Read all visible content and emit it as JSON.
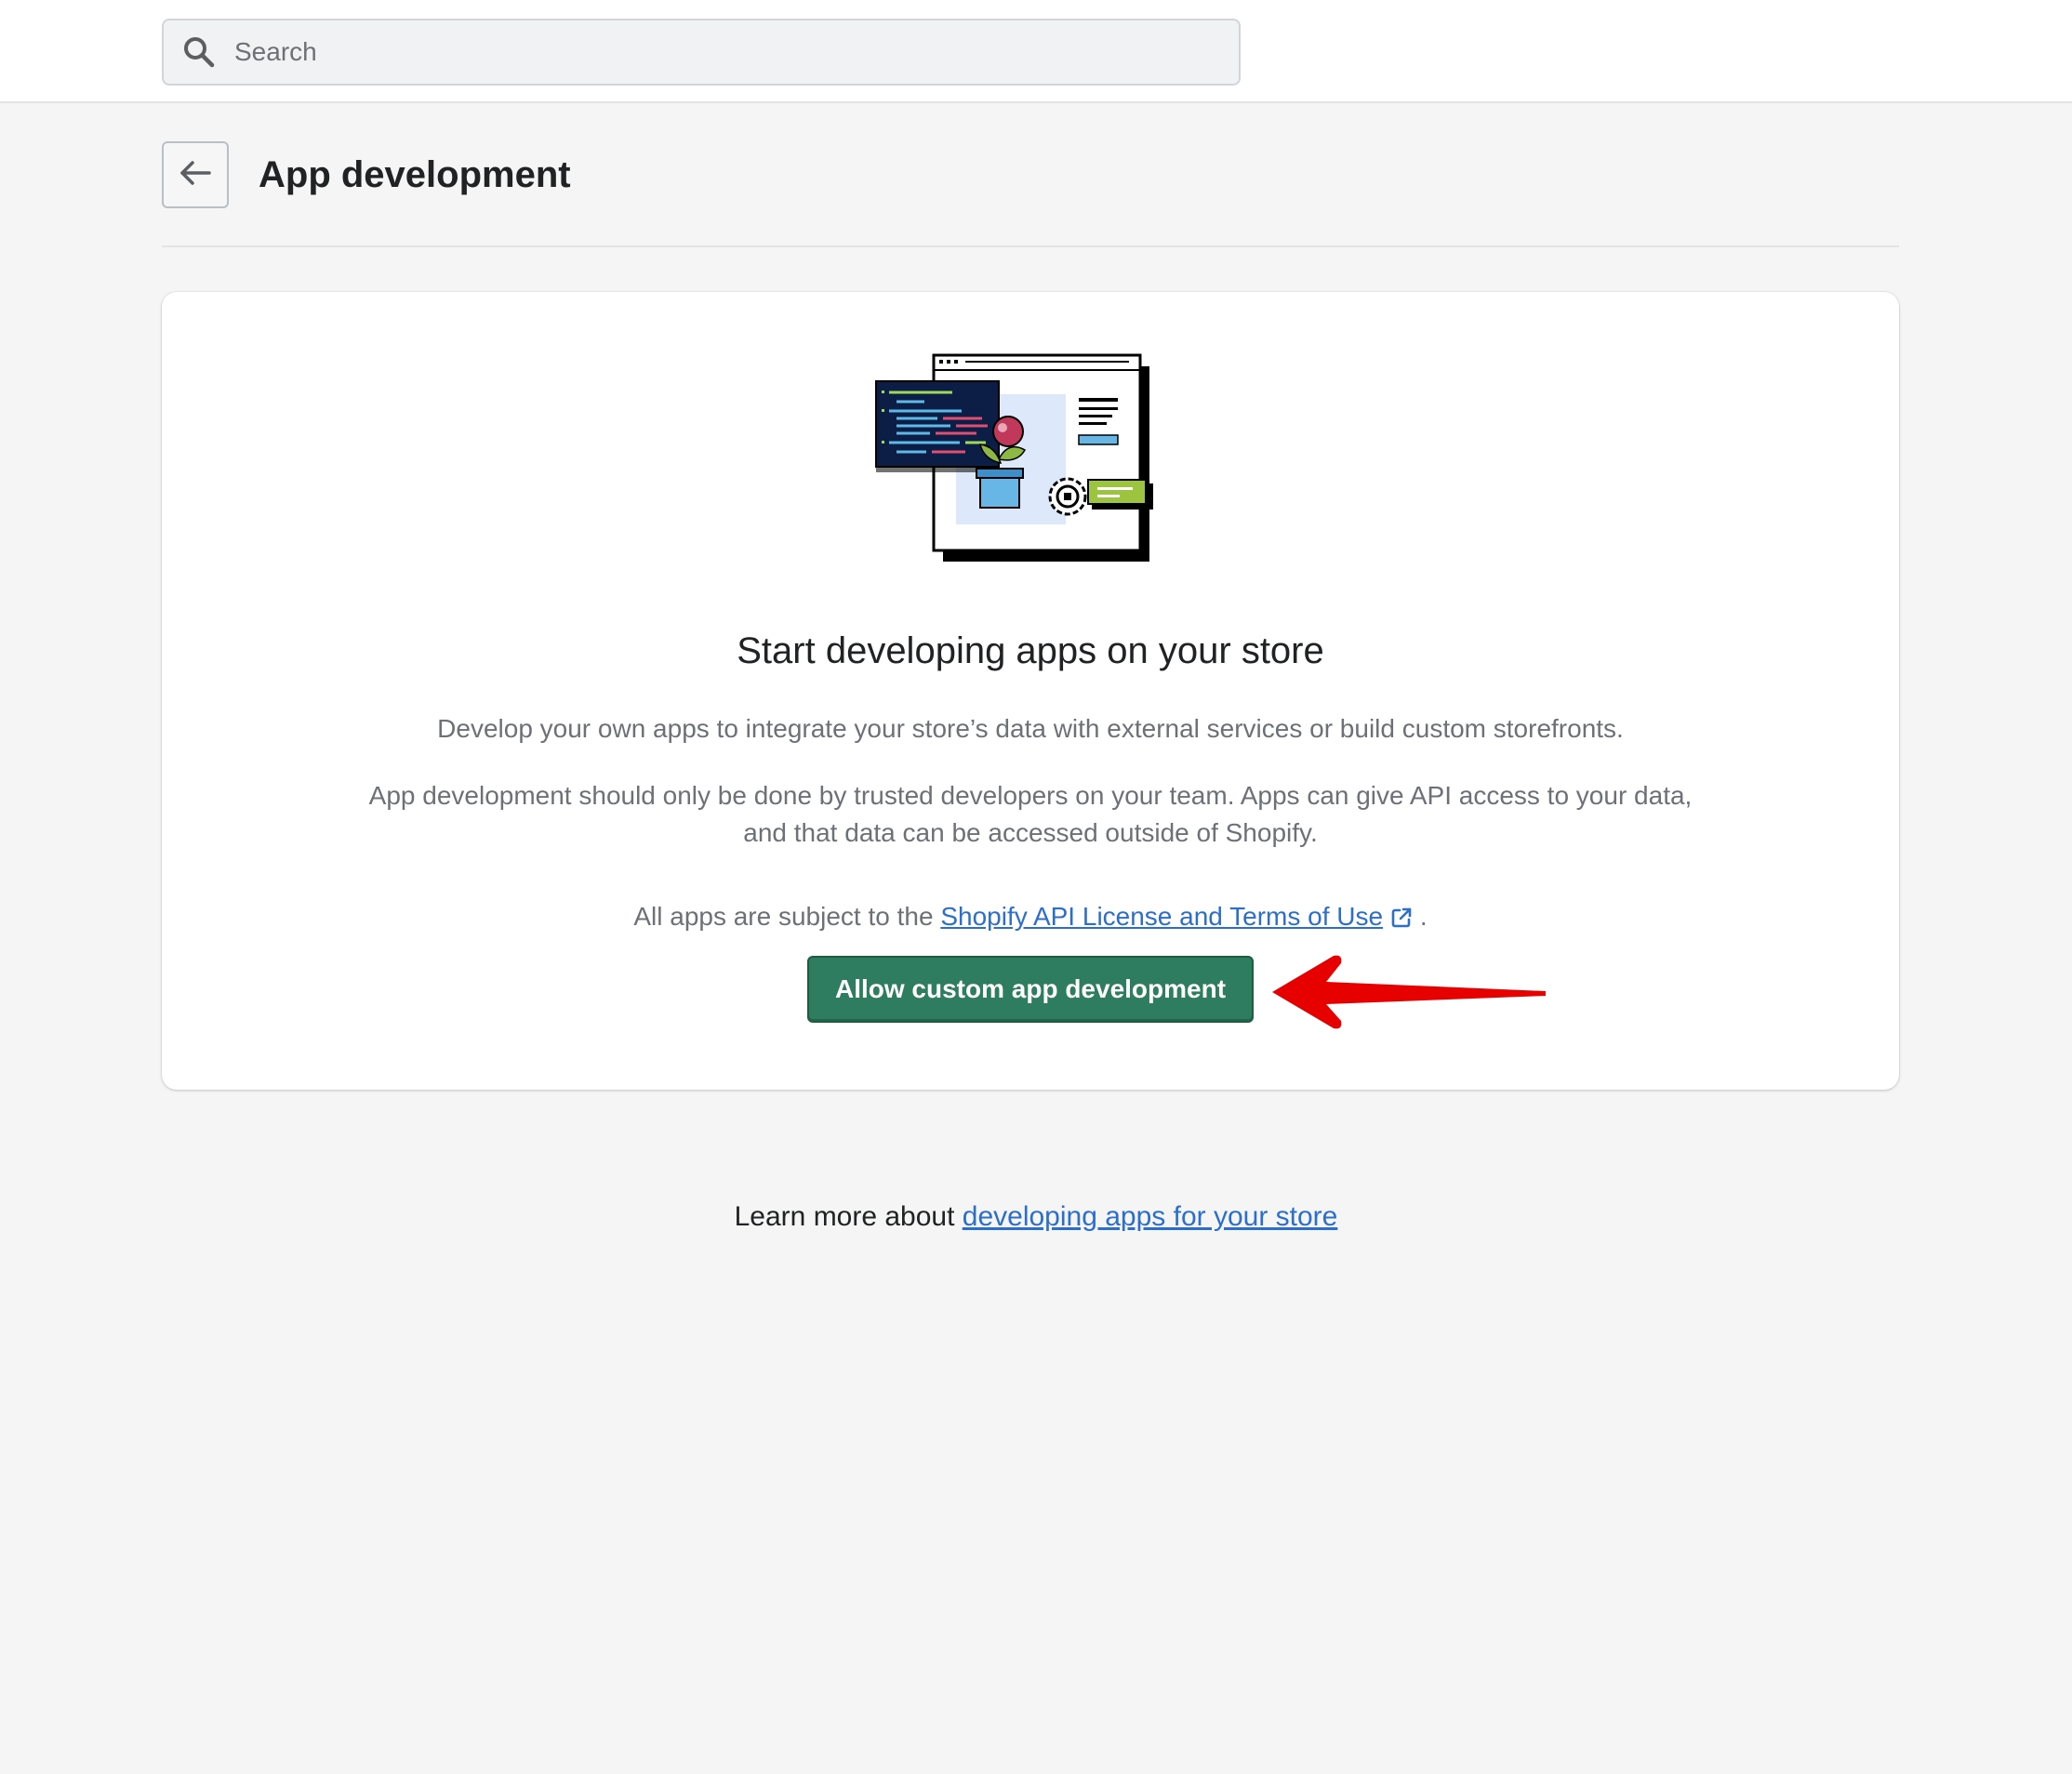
{
  "search": {
    "placeholder": "Search",
    "icon": "search-icon"
  },
  "header": {
    "back_icon": "arrow-left-icon",
    "title": "App development"
  },
  "card": {
    "illustration": "app-development-illustration",
    "heading": "Start developing apps on your store",
    "paragraph_1": "Develop your own apps to integrate your store’s data with external services or build custom storefronts.",
    "paragraph_2": "App development should only be done by trusted developers on your team. Apps can give API access to your data, and that data can be accessed outside of Shopify.",
    "terms_prefix": "All apps are subject to the ",
    "terms_link": "Shopify API License and Terms of Use",
    "terms_icon": "external-link-icon",
    "terms_suffix": " .",
    "primary_button": "Allow custom app development"
  },
  "annotation": {
    "arrow_icon": "red-arrow-icon",
    "color": "#e60000"
  },
  "footer": {
    "prefix": "Learn more about ",
    "link": "developing apps for your store"
  },
  "colors": {
    "primary": "#2f7d60",
    "link": "#2c6ecb",
    "background": "#f5f5f5"
  }
}
